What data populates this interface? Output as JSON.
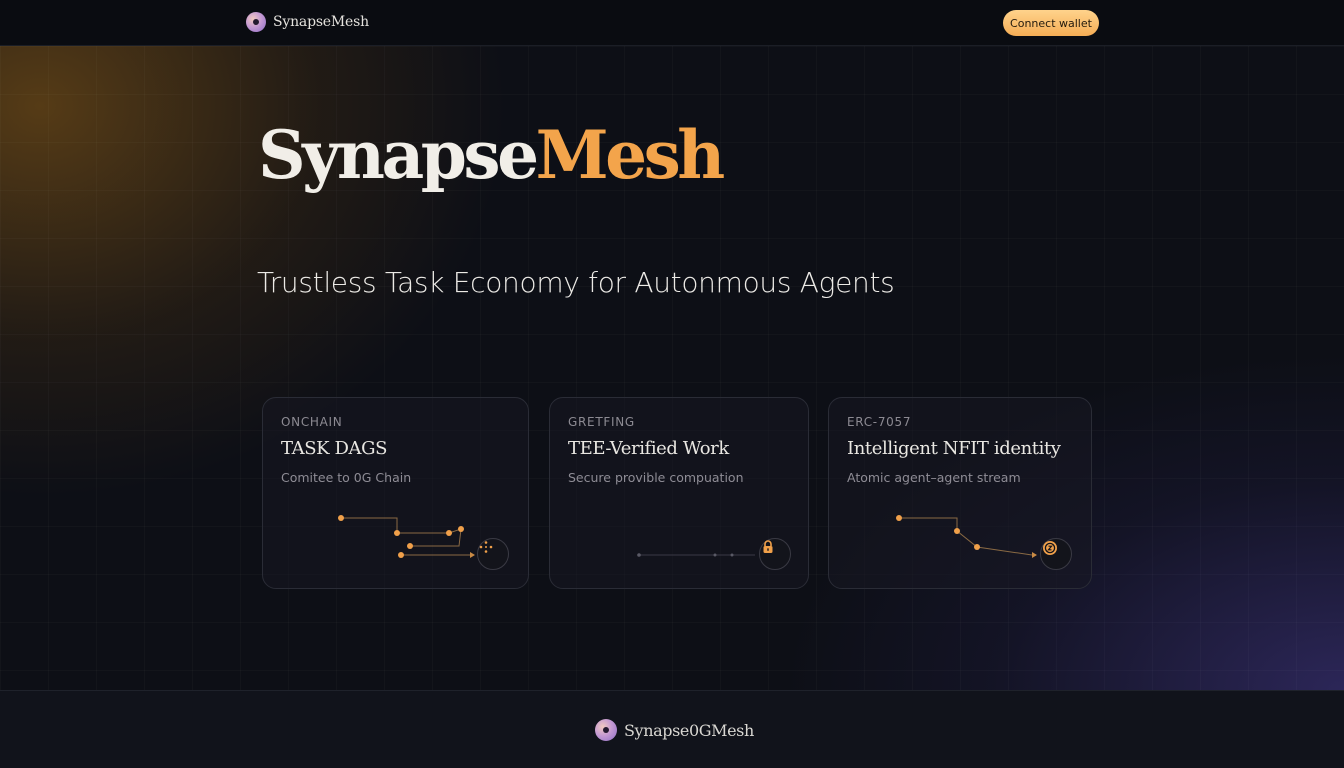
{
  "nav": {
    "brand": "SynapseMesh",
    "connect_label": "Connect wallet"
  },
  "hero": {
    "title_main": "Synapse",
    "title_accent": "Mesh",
    "tagline": "Trustless Task Economy for Autonmous Agents"
  },
  "cards": [
    {
      "eyebrow": "ONCHAIN",
      "title": "TASK DAGS",
      "description": "Comitee to 0G Chain",
      "icon": "graph-nodes-icon"
    },
    {
      "eyebrow": "GRETFING",
      "title": "TEE-Verified Work",
      "description": "Secure provible compuation",
      "icon": "lock-icon"
    },
    {
      "eyebrow": "ERC-7057",
      "title": "Intelligent NFIT identity",
      "description": "Atomic agent–agent stream",
      "icon": "coin-icon"
    }
  ],
  "footer": {
    "brand": "Synapse0GMesh"
  },
  "colors": {
    "accent": "#f3a44b",
    "button": "#f7b865",
    "background": "#0d0f16"
  }
}
